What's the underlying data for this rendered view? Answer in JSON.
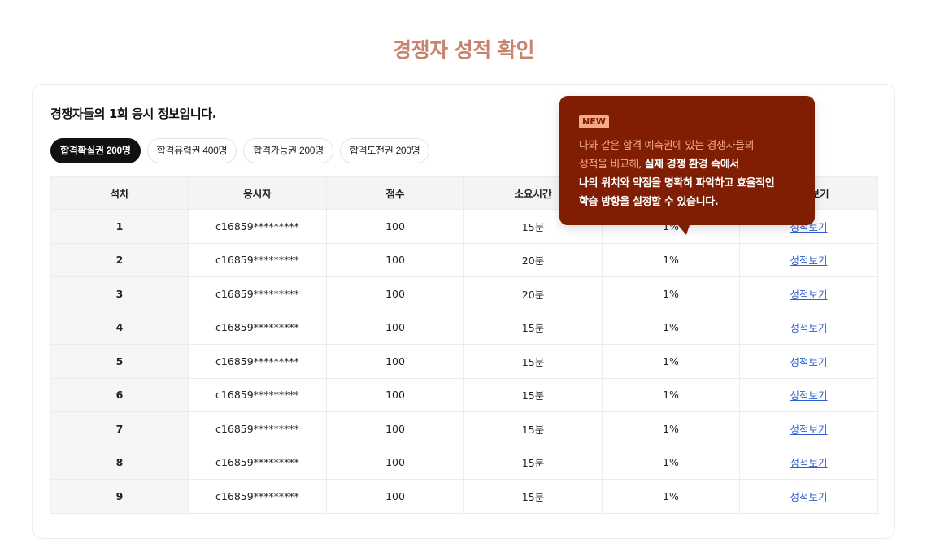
{
  "page": {
    "title": "경쟁자 성적 확인"
  },
  "card": {
    "heading": "경쟁자들의 1회 응시 정보입니다."
  },
  "filters": [
    {
      "label": "합격확실권 200명",
      "active": true
    },
    {
      "label": "합격유력권 400명",
      "active": false
    },
    {
      "label": "합격가능권 200명",
      "active": false
    },
    {
      "label": "합격도전권 200명",
      "active": false
    }
  ],
  "table": {
    "headers": [
      "석차",
      "응시자",
      "점수",
      "소요시간",
      "",
      "성적 보기"
    ],
    "rows": [
      {
        "rank": "1",
        "user": "c16859*********",
        "score": "100",
        "time": "15분",
        "pct": "1%",
        "link": "성적보기"
      },
      {
        "rank": "2",
        "user": "c16859*********",
        "score": "100",
        "time": "20분",
        "pct": "1%",
        "link": "성적보기"
      },
      {
        "rank": "3",
        "user": "c16859*********",
        "score": "100",
        "time": "20분",
        "pct": "1%",
        "link": "성적보기"
      },
      {
        "rank": "4",
        "user": "c16859*********",
        "score": "100",
        "time": "15분",
        "pct": "1%",
        "link": "성적보기"
      },
      {
        "rank": "5",
        "user": "c16859*********",
        "score": "100",
        "time": "15분",
        "pct": "1%",
        "link": "성적보기"
      },
      {
        "rank": "6",
        "user": "c16859*********",
        "score": "100",
        "time": "15분",
        "pct": "1%",
        "link": "성적보기"
      },
      {
        "rank": "7",
        "user": "c16859*********",
        "score": "100",
        "time": "15분",
        "pct": "1%",
        "link": "성적보기"
      },
      {
        "rank": "8",
        "user": "c16859*********",
        "score": "100",
        "time": "15분",
        "pct": "1%",
        "link": "성적보기"
      },
      {
        "rank": "9",
        "user": "c16859*********",
        "score": "100",
        "time": "15분",
        "pct": "1%",
        "link": "성적보기"
      }
    ]
  },
  "tooltip": {
    "badge": "NEW",
    "line1": "나와 같은 합격 예측권에 있는 경쟁자들의",
    "line2_soft": "성적을 비교해, ",
    "line2_strong": "실제 경쟁 환경 속에서",
    "line3": "나의 위치와 약점을 명확히 파악하고 효율적인",
    "line4": "학습 방향을 설정할 수 있습니다."
  },
  "colors": {
    "title": "#c8836d",
    "tooltip_bg": "#7f1e02",
    "badge_bg": "#f7a98a",
    "link": "#2f5fd0"
  }
}
